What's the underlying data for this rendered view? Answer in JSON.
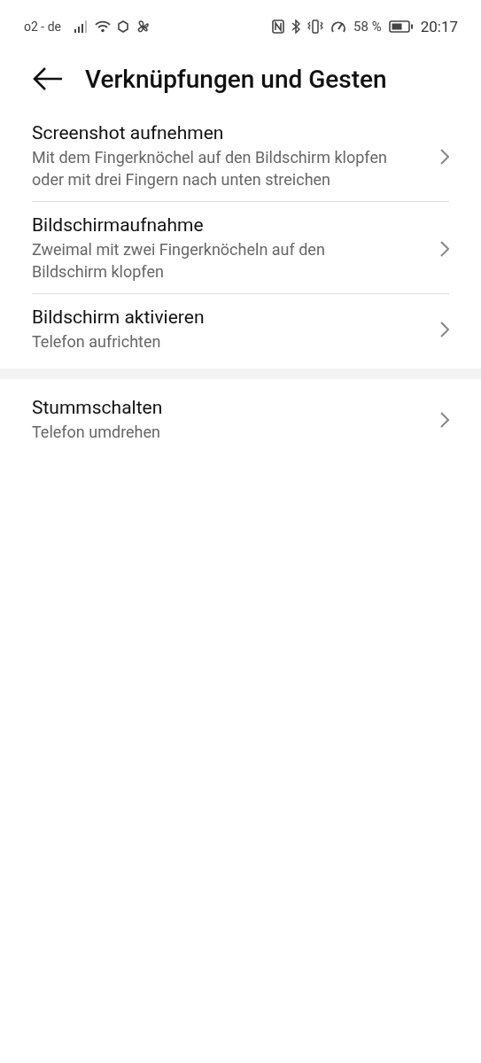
{
  "status_bar": {
    "carrier": "o2 - de",
    "battery_text": "58 %",
    "time": "20:17"
  },
  "header": {
    "title": "Verknüpfungen und Gesten"
  },
  "groups": [
    {
      "items": [
        {
          "title": "Screenshot aufnehmen",
          "subtitle": "Mit dem Fingerknöchel auf den Bildschirm klopfen oder mit drei Fingern nach unten streichen"
        },
        {
          "title": "Bildschirmaufnahme",
          "subtitle": "Zweimal mit zwei Fingerknöcheln auf den Bildschirm klopfen"
        },
        {
          "title": "Bildschirm aktivieren",
          "subtitle": "Telefon aufrichten"
        }
      ]
    },
    {
      "items": [
        {
          "title": "Stummschalten",
          "subtitle": "Telefon umdrehen"
        }
      ]
    }
  ]
}
